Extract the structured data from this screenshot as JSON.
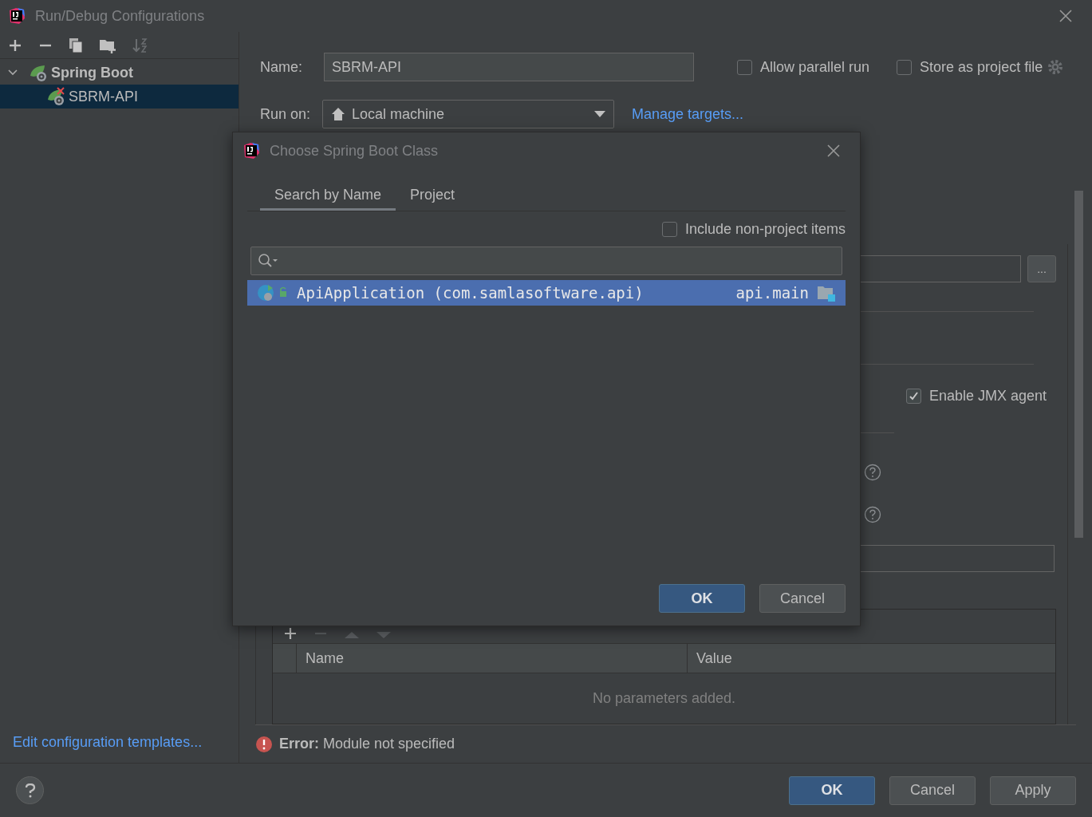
{
  "window": {
    "title": "Run/Debug Configurations"
  },
  "sidebar": {
    "tree": [
      {
        "label": "Spring Boot",
        "expanded": true,
        "selected": false,
        "children": [
          {
            "label": "SBRM-API",
            "selected": true,
            "error": true
          }
        ]
      }
    ],
    "footer_link": "Edit configuration templates..."
  },
  "form": {
    "name_label": "Name:",
    "name_value": "SBRM-API",
    "allow_parallel": {
      "label": "Allow parallel run",
      "checked": false
    },
    "store_project": {
      "label": "Store as project file",
      "checked": false
    },
    "run_on_label": "Run on:",
    "run_on_value": "Local machine",
    "manage_targets": "Manage targets...",
    "path_button": "...",
    "jmx": {
      "label": "Enable JMX agent",
      "checked": true
    },
    "params_table": {
      "columns": [
        "Name",
        "Value"
      ],
      "empty": "No parameters added."
    }
  },
  "error": {
    "prefix": "Error:",
    "message": "Module not specified"
  },
  "buttons": [
    {
      "label": "OK",
      "primary": true
    },
    {
      "label": "Cancel",
      "primary": false
    },
    {
      "label": "Apply",
      "primary": false
    }
  ],
  "dialog": {
    "title": "Choose Spring Boot Class",
    "tabs": [
      {
        "label": "Search by Name",
        "selected": true
      },
      {
        "label": "Project",
        "selected": false
      }
    ],
    "include_non_project": {
      "label": "Include non-project items",
      "checked": false
    },
    "results": [
      {
        "name": "ApiApplication (com.samlasoftware.api)",
        "module": "api.main",
        "selected": true
      }
    ],
    "buttons": [
      {
        "label": "OK",
        "primary": true
      },
      {
        "label": "Cancel",
        "primary": false
      }
    ]
  }
}
